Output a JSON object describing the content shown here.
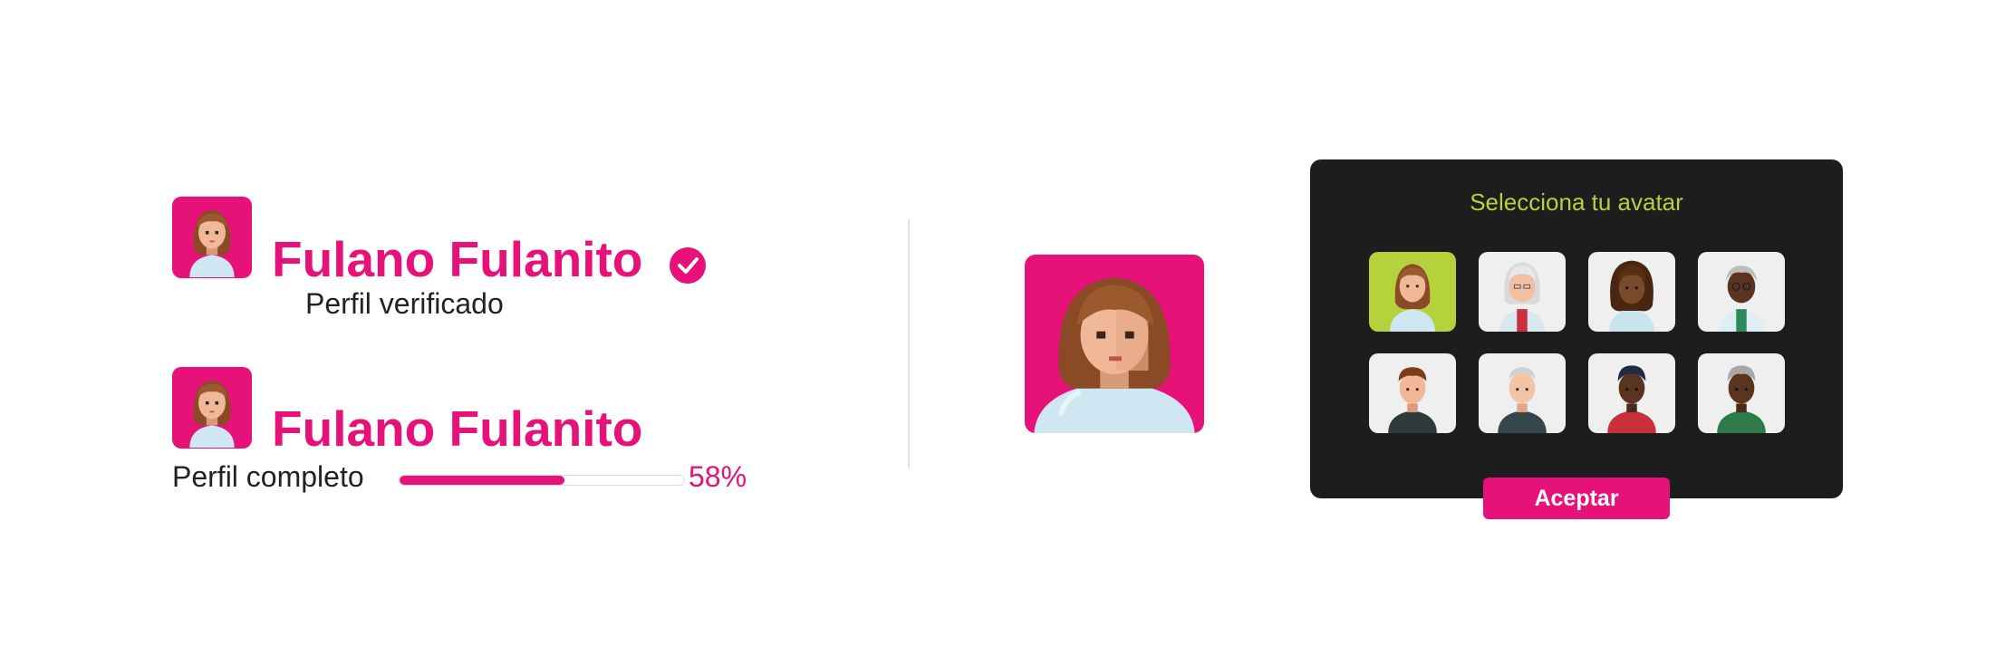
{
  "profiles": [
    {
      "name": "Fulano Fulanito",
      "status_label": "Perfil verificado",
      "verified_icon": "check-circle-icon"
    },
    {
      "name": "Fulano Fulanito",
      "progress_label": "Perfil completo",
      "progress_fraction": 0.58,
      "progress_text": "58%"
    }
  ],
  "avatar_picker": {
    "title": "Selecciona tu avatar",
    "accept_label": "Aceptar",
    "selected_index": 0,
    "options": [
      "avatar-woman-brown-hair",
      "avatar-elderly-woman-gray-hair",
      "avatar-woman-curly-hair",
      "avatar-elderly-man-glasses",
      "avatar-man-brown-hair",
      "avatar-elderly-man-gray-hair",
      "avatar-man-dark-skin",
      "avatar-elderly-man-dark-skin"
    ]
  },
  "colors": {
    "brand": "#e6127a",
    "accent": "#b5d13b",
    "panel": "#1d1d1d",
    "tile": "#efefef"
  }
}
